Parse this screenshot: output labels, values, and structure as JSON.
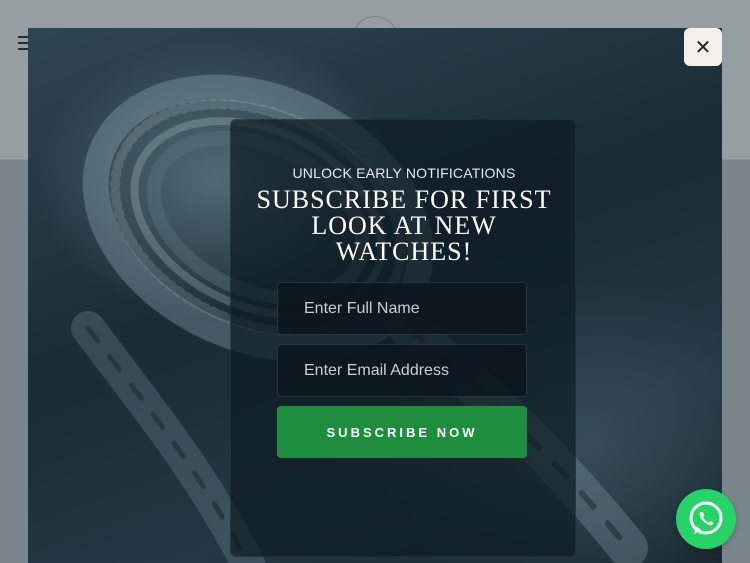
{
  "modal": {
    "eyebrow": "UNLOCK EARLY NOTIFICATIONS",
    "headline": "SUBSCRIBE FOR FIRST LOOK AT NEW WATCHES!",
    "name_placeholder": "Enter Full Name",
    "email_placeholder": "Enter Email Address",
    "submit_label": "SUBSCRIBE NOW",
    "close_label": "✕"
  },
  "icons": {
    "close": "close-icon",
    "whatsapp": "whatsapp-icon",
    "menu": "hamburger-menu-icon"
  },
  "colors": {
    "submit_bg": "#1e8e3e",
    "whatsapp_bg": "#25d366",
    "close_bg": "#f2f0ec"
  }
}
